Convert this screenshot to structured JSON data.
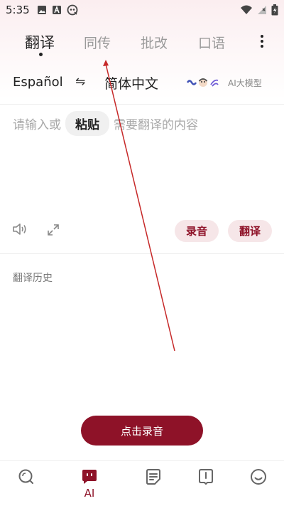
{
  "status_bar": {
    "time": "5:35",
    "icons_left": [
      "image-icon",
      "a-icon",
      "shortcut-icon"
    ],
    "icons_right": [
      "wifi-icon",
      "signal-icon",
      "battery-icon"
    ]
  },
  "tabs": [
    {
      "label": "翻译",
      "active": true
    },
    {
      "label": "同传",
      "active": false
    },
    {
      "label": "批改",
      "active": false
    },
    {
      "label": "口语",
      "active": false
    }
  ],
  "language": {
    "source": "Español",
    "swap_symbol": "⇋",
    "target": "简体中文",
    "ai_model_label": "AI大模型"
  },
  "input": {
    "placeholder_before": "请输入或",
    "paste_label": "粘贴",
    "placeholder_after": "需要翻译的内容"
  },
  "actions": {
    "record_label": "录音",
    "translate_label": "翻译"
  },
  "history": {
    "title": "翻译历史"
  },
  "record_button": {
    "label": "点击录音"
  },
  "bottom_nav": [
    {
      "name": "search",
      "icon": "search-icon",
      "label": ""
    },
    {
      "name": "ai",
      "icon": "ai-icon",
      "label": "AI",
      "active": true
    },
    {
      "name": "notes",
      "icon": "notes-icon",
      "label": ""
    },
    {
      "name": "book",
      "icon": "book-icon",
      "label": ""
    },
    {
      "name": "me",
      "icon": "smile-icon",
      "label": ""
    }
  ],
  "colors": {
    "accent": "#8e1228",
    "accent_light": "#f6e6e8",
    "annotation_arrow": "#c62828"
  }
}
